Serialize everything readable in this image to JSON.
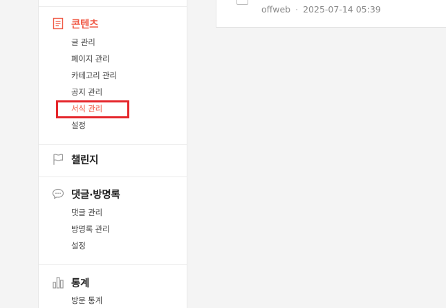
{
  "post": {
    "author": "offweb",
    "separator": "·",
    "datetime": "2025-07-14 05:39"
  },
  "sidebar": {
    "contents": {
      "title": "콘텐츠",
      "icon": "document-icon",
      "items": [
        "글 관리",
        "페이지 관리",
        "카테고리 관리",
        "공지 관리",
        "서식 관리",
        "설정"
      ]
    },
    "challenge": {
      "title": "챌린지",
      "icon": "flag-icon"
    },
    "comments": {
      "title": "댓글·방명록",
      "icon": "speech-bubble-icon",
      "items": [
        "댓글 관리",
        "방명록 관리",
        "설정"
      ]
    },
    "stats": {
      "title": "통계",
      "icon": "bar-chart-icon",
      "items": [
        "방문 통계"
      ]
    }
  },
  "colors": {
    "accent": "#f05a46",
    "highlight_box": "#e5262b"
  }
}
